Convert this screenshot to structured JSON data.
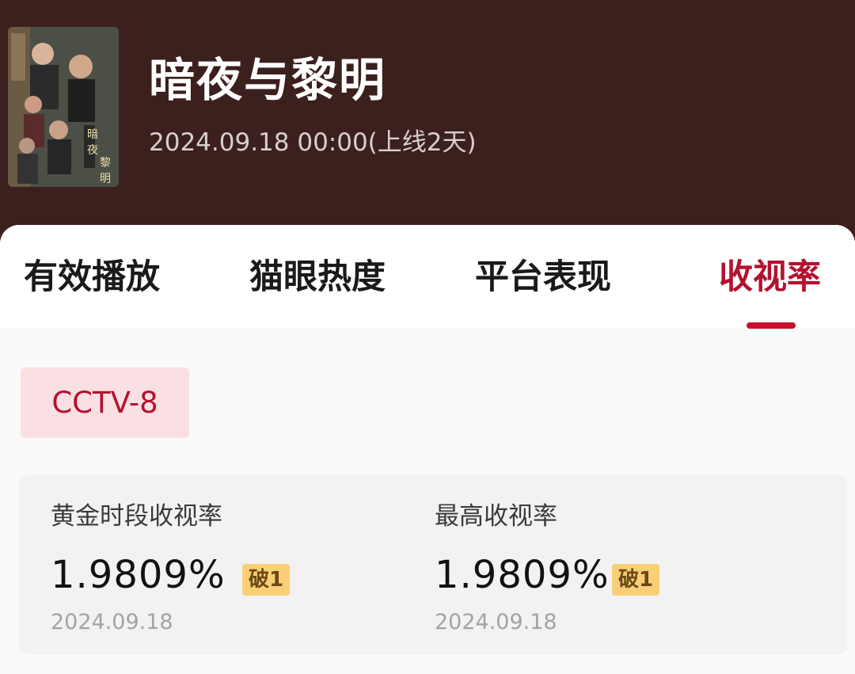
{
  "show": {
    "title": "暗夜与黎明",
    "release": "2024.09.18 00:00(上线2天)"
  },
  "tabs": [
    {
      "label": "有效播放",
      "active": false
    },
    {
      "label": "猫眼热度",
      "active": false
    },
    {
      "label": "平台表现",
      "active": false
    },
    {
      "label": "收视率",
      "active": true
    }
  ],
  "channel": {
    "label": "CCTV-8",
    "selected": true
  },
  "stats": [
    {
      "label": "黄金时段收视率",
      "value": "1.9809%",
      "badge": "破1",
      "date": "2024.09.18"
    },
    {
      "label": "最高收视率",
      "value": "1.9809%",
      "badge": "破1",
      "date": "2024.09.18"
    }
  ],
  "colors": {
    "header_bg": "#3b201e",
    "accent": "#b3122e",
    "chip_bg": "#fbe0e3",
    "badge_bg": "#f8cf76",
    "card_bg": "#f2f2f3"
  },
  "icons": {
    "poster": "poster-image"
  }
}
